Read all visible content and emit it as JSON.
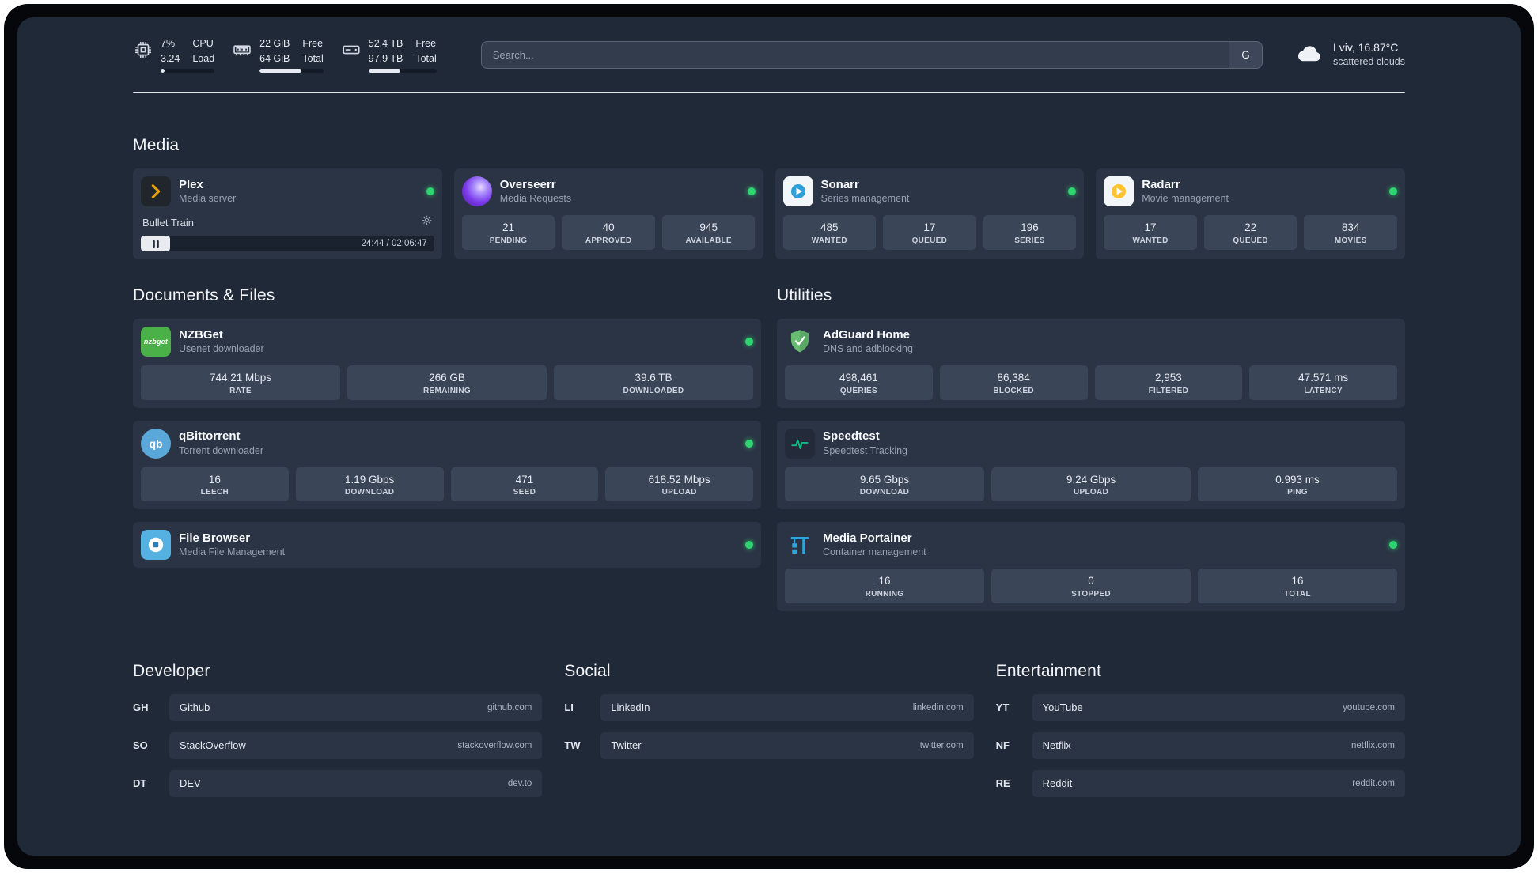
{
  "topbar": {
    "resources": [
      {
        "icon": "cpu-icon",
        "values": [
          "7%",
          "3.24"
        ],
        "labels": [
          "CPU",
          "Load"
        ],
        "progress": 7
      },
      {
        "icon": "memory-icon",
        "values": [
          "22 GiB",
          "64 GiB"
        ],
        "labels": [
          "Free",
          "Total"
        ],
        "progress": 66
      },
      {
        "icon": "disk-icon",
        "values": [
          "52.4 TB",
          "97.9 TB"
        ],
        "labels": [
          "Free",
          "Total"
        ],
        "progress": 47
      }
    ],
    "search": {
      "placeholder": "Search...",
      "provider": "G"
    },
    "weather": {
      "location": "Lviv, 16.87°C",
      "condition": "scattered clouds"
    }
  },
  "groups": {
    "media": {
      "title": "Media",
      "plex": {
        "name": "Plex",
        "subtitle": "Media server",
        "now_playing": "Bullet Train",
        "time": "24:44 / 02:06:47",
        "progress": 10
      },
      "overseerr": {
        "name": "Overseerr",
        "subtitle": "Media Requests",
        "stats": [
          {
            "value": "21",
            "label": "PENDING"
          },
          {
            "value": "40",
            "label": "APPROVED"
          },
          {
            "value": "945",
            "label": "AVAILABLE"
          }
        ]
      },
      "sonarr": {
        "name": "Sonarr",
        "subtitle": "Series management",
        "stats": [
          {
            "value": "485",
            "label": "WANTED"
          },
          {
            "value": "17",
            "label": "QUEUED"
          },
          {
            "value": "196",
            "label": "SERIES"
          }
        ]
      },
      "radarr": {
        "name": "Radarr",
        "subtitle": "Movie management",
        "stats": [
          {
            "value": "17",
            "label": "WANTED"
          },
          {
            "value": "22",
            "label": "QUEUED"
          },
          {
            "value": "834",
            "label": "MOVIES"
          }
        ]
      }
    },
    "documents": {
      "title": "Documents & Files",
      "nzbget": {
        "name": "NZBGet",
        "subtitle": "Usenet downloader",
        "stats": [
          {
            "value": "744.21 Mbps",
            "label": "RATE"
          },
          {
            "value": "266 GB",
            "label": "REMAINING"
          },
          {
            "value": "39.6 TB",
            "label": "DOWNLOADED"
          }
        ]
      },
      "qbittorrent": {
        "name": "qBittorrent",
        "subtitle": "Torrent downloader",
        "stats": [
          {
            "value": "16",
            "label": "LEECH"
          },
          {
            "value": "1.19 Gbps",
            "label": "DOWNLOAD"
          },
          {
            "value": "471",
            "label": "SEED"
          },
          {
            "value": "618.52 Mbps",
            "label": "UPLOAD"
          }
        ]
      },
      "filebrowser": {
        "name": "File Browser",
        "subtitle": "Media File Management"
      }
    },
    "utilities": {
      "title": "Utilities",
      "adguard": {
        "name": "AdGuard Home",
        "subtitle": "DNS and adblocking",
        "stats": [
          {
            "value": "498,461",
            "label": "QUERIES"
          },
          {
            "value": "86,384",
            "label": "BLOCKED"
          },
          {
            "value": "2,953",
            "label": "FILTERED"
          },
          {
            "value": "47.571 ms",
            "label": "LATENCY"
          }
        ]
      },
      "speedtest": {
        "name": "Speedtest",
        "subtitle": "Speedtest Tracking",
        "stats": [
          {
            "value": "9.65 Gbps",
            "label": "DOWNLOAD"
          },
          {
            "value": "9.24 Gbps",
            "label": "UPLOAD"
          },
          {
            "value": "0.993 ms",
            "label": "PING"
          }
        ]
      },
      "portainer": {
        "name": "Media Portainer",
        "subtitle": "Container management",
        "stats": [
          {
            "value": "16",
            "label": "RUNNING"
          },
          {
            "value": "0",
            "label": "STOPPED"
          },
          {
            "value": "16",
            "label": "TOTAL"
          }
        ]
      }
    }
  },
  "bookmarks": [
    {
      "title": "Developer",
      "items": [
        {
          "abbr": "GH",
          "name": "Github",
          "domain": "github.com"
        },
        {
          "abbr": "SO",
          "name": "StackOverflow",
          "domain": "stackoverflow.com"
        },
        {
          "abbr": "DT",
          "name": "DEV",
          "domain": "dev.to"
        }
      ]
    },
    {
      "title": "Social",
      "items": [
        {
          "abbr": "LI",
          "name": "LinkedIn",
          "domain": "linkedin.com"
        },
        {
          "abbr": "TW",
          "name": "Twitter",
          "domain": "twitter.com"
        }
      ]
    },
    {
      "title": "Entertainment",
      "items": [
        {
          "abbr": "YT",
          "name": "YouTube",
          "domain": "youtube.com"
        },
        {
          "abbr": "NF",
          "name": "Netflix",
          "domain": "netflix.com"
        },
        {
          "abbr": "RE",
          "name": "Reddit",
          "domain": "reddit.com"
        }
      ]
    }
  ],
  "icons": {
    "nzbget_text": "nzbget",
    "qbittorrent_text": "qb",
    "topbar": [
      "cpu-chip-outline",
      "ram-stick-outline",
      "disk-drive-outline"
    ],
    "weather": "cloud",
    "plex_controls": [
      "gear",
      "pause"
    ],
    "status": "green-dot"
  },
  "colors": {
    "status_online": "#2dd46f",
    "page_bg": "#202938",
    "card_bg": "#2b3444",
    "stat_bg": "#3a4557",
    "plex": "#e5a00d",
    "overseerr": "#7c3aed",
    "sonarr": "#2f9fd8",
    "radarr": "#ffc230",
    "nzbget": "#4ab148",
    "qbittorrent": "#5aa7d9",
    "filebrowser": "#56b1e3",
    "adguard": "#68bc71",
    "speedtest": "#10b981",
    "portainer": "#2aa7df"
  }
}
